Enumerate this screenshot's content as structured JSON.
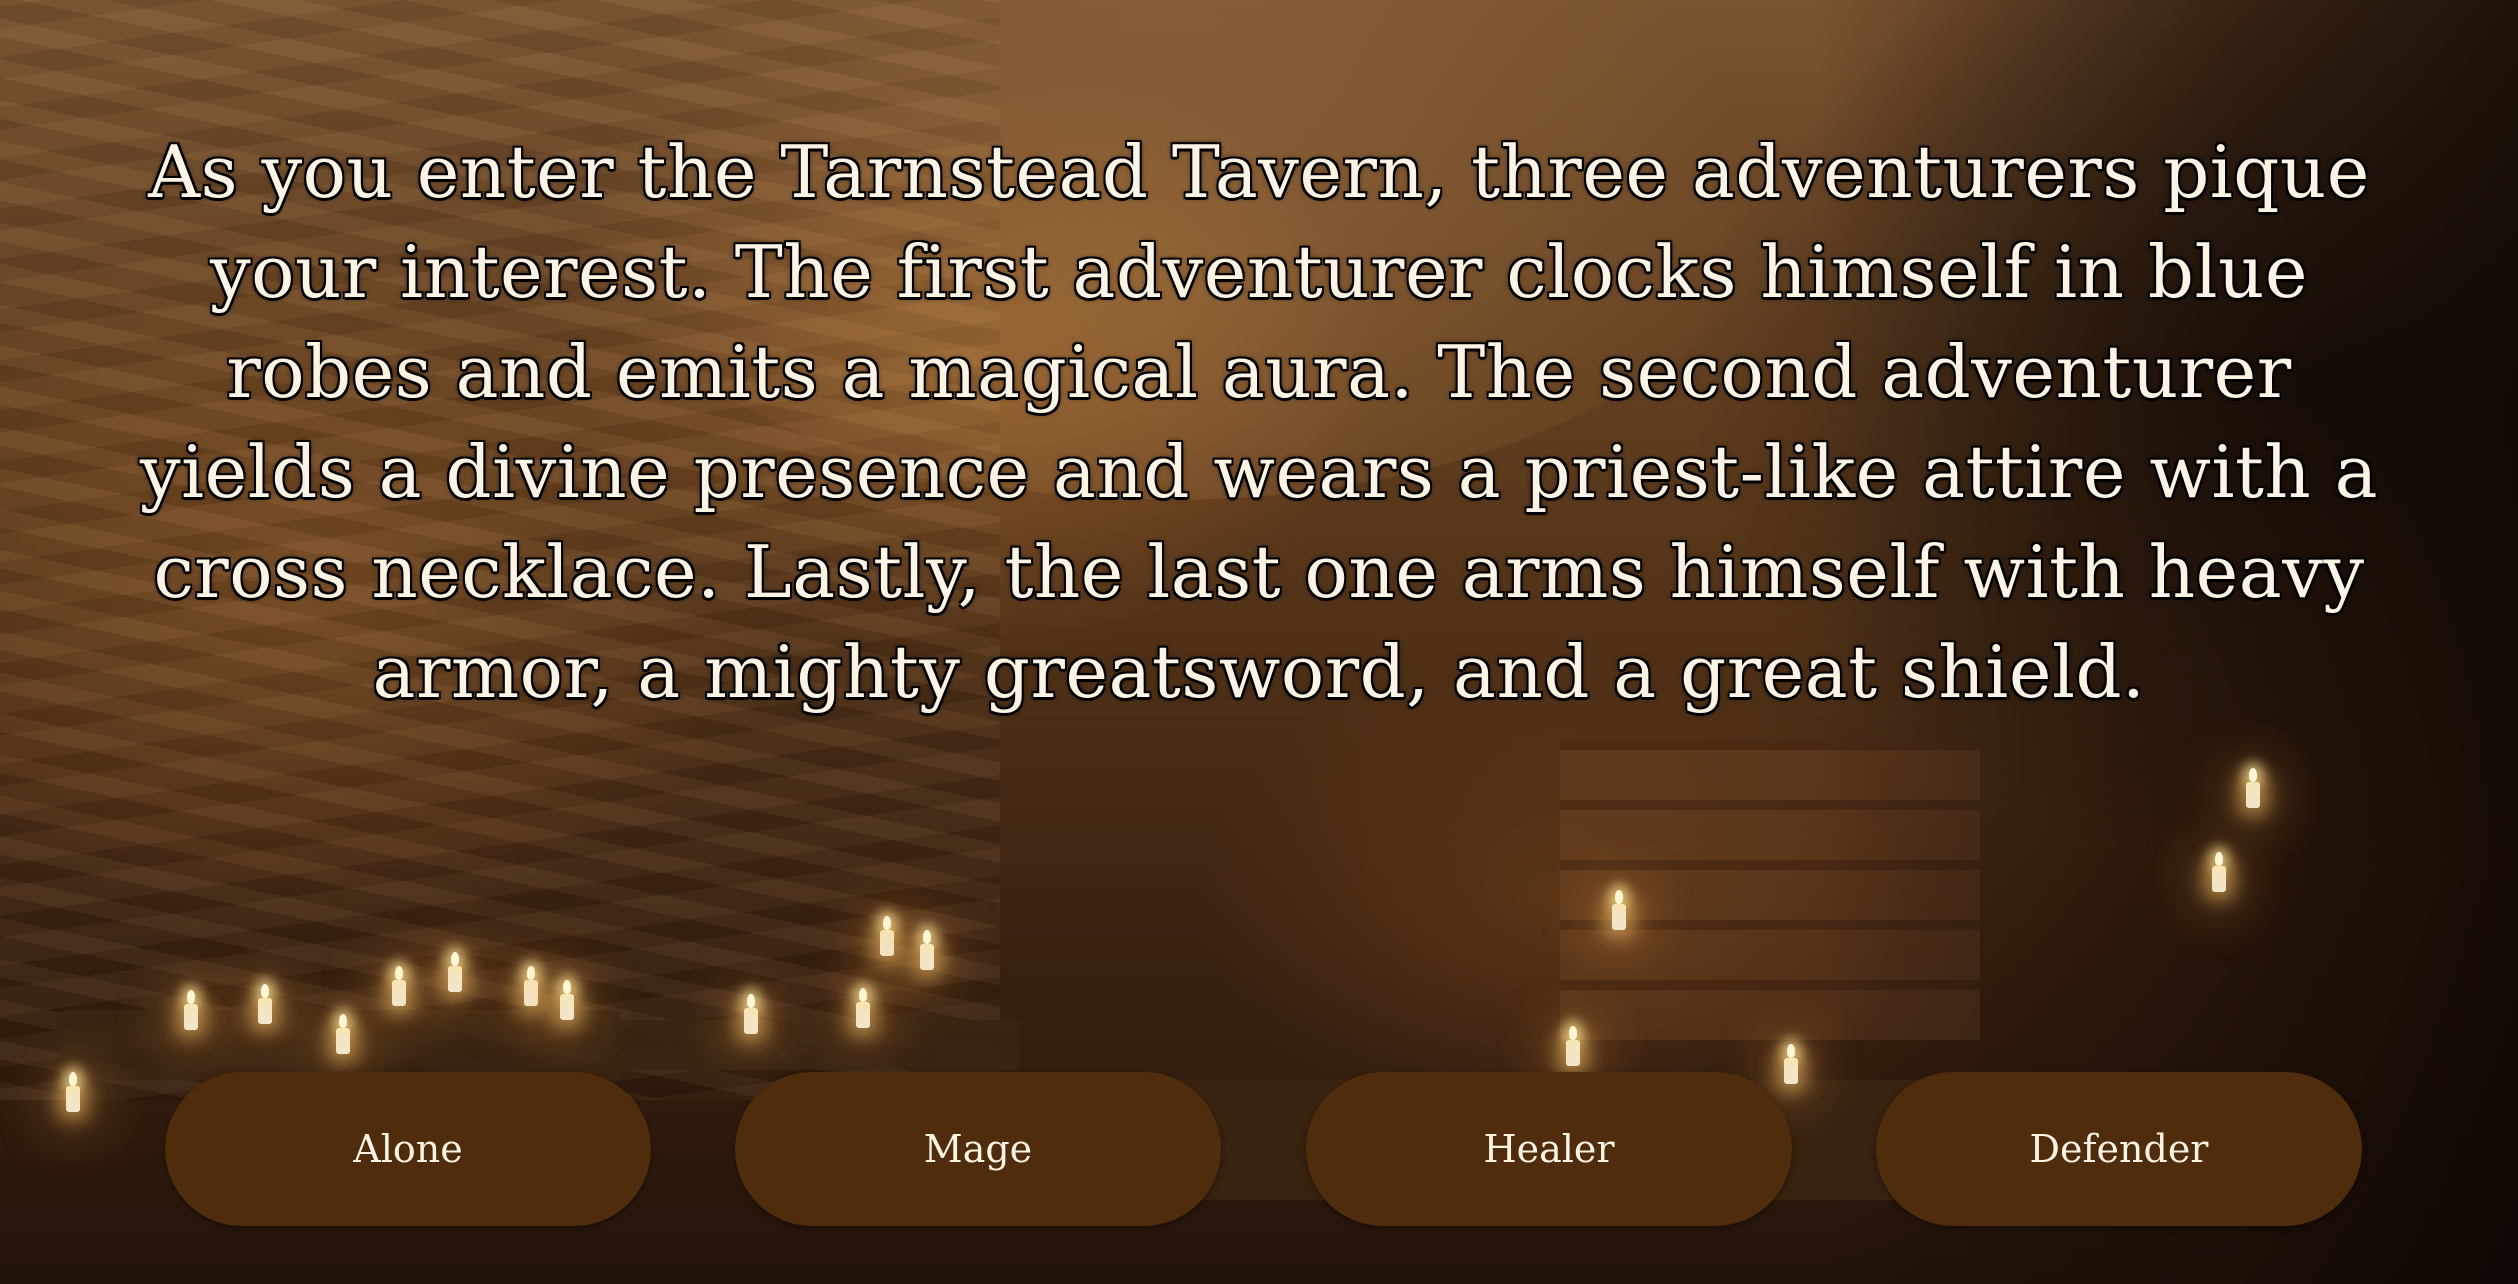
{
  "story": {
    "text": "As you enter the Tarnstead Tavern, three adventurers pique your interest. The first adventurer clocks himself in blue robes and emits a magical aura. The second adventurer yields a divine presence and wears a priest-like attire with a cross necklace. Lastly, the last one arms himself with heavy armor, a mighty greatsword, and a great shield."
  },
  "choices": [
    {
      "label": "Alone"
    },
    {
      "label": "Mage"
    },
    {
      "label": "Healer"
    },
    {
      "label": "Defender"
    }
  ],
  "colors": {
    "button_bg": "#4f2c0c",
    "text": "#fbf3e4"
  }
}
